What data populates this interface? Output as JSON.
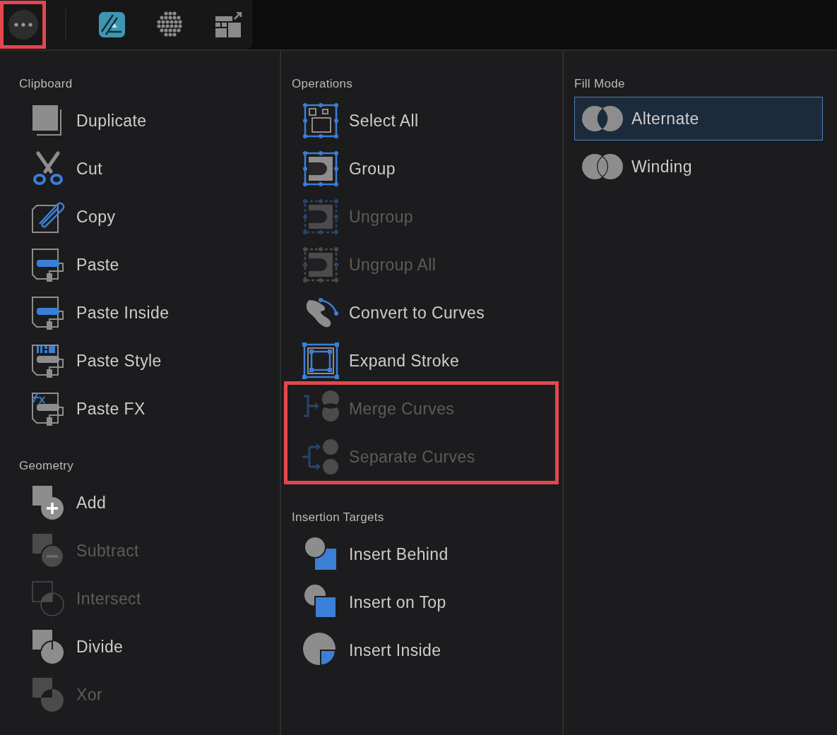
{
  "toolbar": {
    "more_button": {
      "highlighted": true
    }
  },
  "columns": [
    {
      "sections": [
        {
          "title": "Clipboard",
          "items": [
            {
              "label": "Duplicate",
              "disabled": false,
              "highlighted": false
            },
            {
              "label": "Cut",
              "disabled": false,
              "highlighted": false
            },
            {
              "label": "Copy",
              "disabled": false,
              "highlighted": false
            },
            {
              "label": "Paste",
              "disabled": false,
              "highlighted": false
            },
            {
              "label": "Paste Inside",
              "disabled": false,
              "highlighted": false
            },
            {
              "label": "Paste Style",
              "disabled": false,
              "highlighted": false
            },
            {
              "label": "Paste FX",
              "disabled": false,
              "highlighted": false
            }
          ]
        },
        {
          "title": "Geometry",
          "items": [
            {
              "label": "Add",
              "disabled": false,
              "highlighted": false
            },
            {
              "label": "Subtract",
              "disabled": true,
              "highlighted": false
            },
            {
              "label": "Intersect",
              "disabled": true,
              "highlighted": false
            },
            {
              "label": "Divide",
              "disabled": false,
              "highlighted": false
            },
            {
              "label": "Xor",
              "disabled": true,
              "highlighted": false
            }
          ]
        }
      ]
    },
    {
      "sections": [
        {
          "title": "Operations",
          "items": [
            {
              "label": "Select All",
              "disabled": false,
              "highlighted": false
            },
            {
              "label": "Group",
              "disabled": false,
              "highlighted": false
            },
            {
              "label": "Ungroup",
              "disabled": true,
              "highlighted": false
            },
            {
              "label": "Ungroup All",
              "disabled": true,
              "highlighted": false
            },
            {
              "label": "Convert to Curves",
              "disabled": false,
              "highlighted": false
            },
            {
              "label": "Expand Stroke",
              "disabled": false,
              "highlighted": false
            },
            {
              "label": "Merge Curves",
              "disabled": true,
              "highlighted": true
            },
            {
              "label": "Separate Curves",
              "disabled": true,
              "highlighted": true
            }
          ]
        },
        {
          "title": "Insertion Targets",
          "items": [
            {
              "label": "Insert Behind",
              "disabled": false,
              "highlighted": false
            },
            {
              "label": "Insert on Top",
              "disabled": false,
              "highlighted": false
            },
            {
              "label": "Insert Inside",
              "disabled": false,
              "highlighted": false
            }
          ]
        }
      ]
    },
    {
      "sections": [
        {
          "title": "Fill Mode",
          "kind": "radio",
          "items": [
            {
              "label": "Alternate",
              "selected": true
            },
            {
              "label": "Winding",
              "selected": false
            }
          ]
        }
      ]
    }
  ]
}
